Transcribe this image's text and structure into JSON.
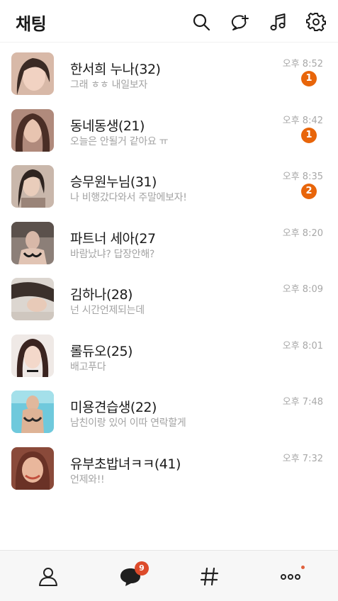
{
  "header": {
    "title": "채팅",
    "icons": [
      "search-icon",
      "new-chat-icon",
      "music-icon",
      "settings-icon"
    ]
  },
  "colors": {
    "badge": "#e8650a",
    "nav_badge": "#dd4b2b",
    "time": "#a8a8a8",
    "preview": "#a3a3a3"
  },
  "chats": [
    {
      "name": "한서희 누나(32)",
      "preview": "그래 ㅎㅎ 내일보자",
      "time": "오후 8:52",
      "unread": "1"
    },
    {
      "name": "동네동생(21)",
      "preview": "오늘은 안될거 같아요 ㅠ",
      "time": "오후 8:42",
      "unread": "1"
    },
    {
      "name": "승무원누님(31)",
      "preview": "나 비행갔다와서 주말에보자!",
      "time": "오후 8:35",
      "unread": "2"
    },
    {
      "name": "파트너 세아(27",
      "preview": "바람났냐? 답장안해?",
      "time": "오후 8:20",
      "unread": ""
    },
    {
      "name": "김하나(28)",
      "preview": "넌 시간언제되는데",
      "time": "오후 8:09",
      "unread": ""
    },
    {
      "name": "롤듀오(25)",
      "preview": "배고푸다",
      "time": "오후 8:01",
      "unread": ""
    },
    {
      "name": "미용견습생(22)",
      "preview": "남친이랑 있어 이따 연락할게",
      "time": "오후 7:48",
      "unread": ""
    },
    {
      "name": "유부초밥녀ㅋㅋ(41)",
      "preview": "언제와!!",
      "time": "오후 7:32",
      "unread": ""
    }
  ],
  "bottom_nav": {
    "items": [
      "person-icon",
      "chat-bubble-icon",
      "hashtag-icon",
      "more-icon"
    ],
    "chat_badge": "9"
  }
}
